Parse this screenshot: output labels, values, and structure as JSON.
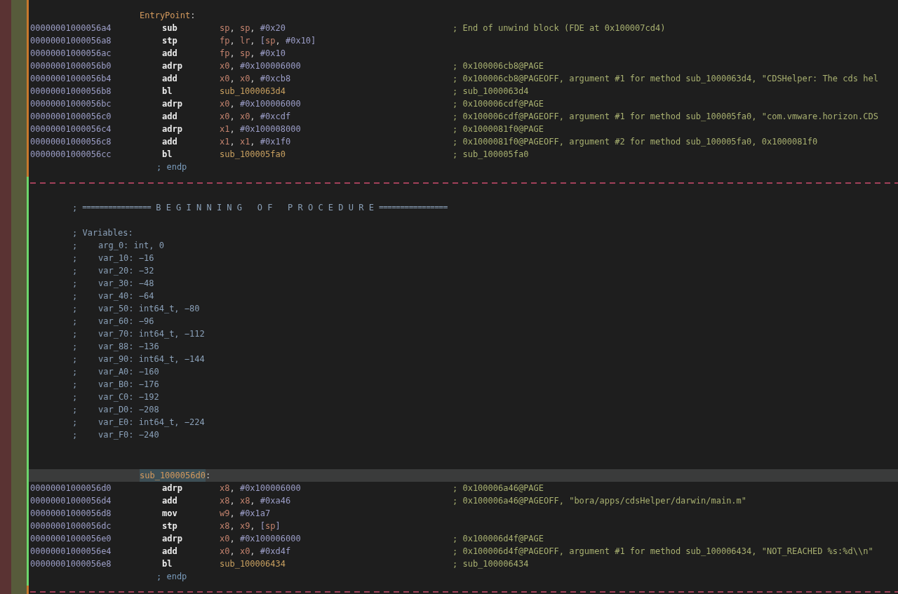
{
  "blocks": [
    {
      "color": "#c8782c",
      "label": {
        "name": "EntryPoint",
        "colon": ":",
        "selected": false
      },
      "instructions": [
        {
          "address": "00000001000056a4",
          "mnemonic": "sub",
          "operands": [
            {
              "kind": "reg",
              "text": "sp"
            },
            {
              "kind": "punct",
              "text": ", "
            },
            {
              "kind": "reg",
              "text": "sp"
            },
            {
              "kind": "punct",
              "text": ", "
            },
            {
              "kind": "imm",
              "text": "#0x20"
            }
          ],
          "comment": "; End of unwind block (FDE at 0x100007cd4)"
        },
        {
          "address": "00000001000056a8",
          "mnemonic": "stp",
          "operands": [
            {
              "kind": "reg",
              "text": "fp"
            },
            {
              "kind": "punct",
              "text": ", "
            },
            {
              "kind": "reg",
              "text": "lr"
            },
            {
              "kind": "punct",
              "text": ", "
            },
            {
              "kind": "imm",
              "text": "["
            },
            {
              "kind": "reg",
              "text": "sp"
            },
            {
              "kind": "punct",
              "text": ", "
            },
            {
              "kind": "imm",
              "text": "#0x10"
            },
            {
              "kind": "imm",
              "text": "]"
            }
          ]
        },
        {
          "address": "00000001000056ac",
          "mnemonic": "add",
          "operands": [
            {
              "kind": "reg",
              "text": "fp"
            },
            {
              "kind": "punct",
              "text": ", "
            },
            {
              "kind": "reg",
              "text": "sp"
            },
            {
              "kind": "punct",
              "text": ", "
            },
            {
              "kind": "imm",
              "text": "#0x10"
            }
          ]
        },
        {
          "address": "00000001000056b0",
          "mnemonic": "adrp",
          "operands": [
            {
              "kind": "reg",
              "text": "x0"
            },
            {
              "kind": "punct",
              "text": ", "
            },
            {
              "kind": "imm",
              "text": "#0x100006000"
            }
          ],
          "comment": "; 0x100006cb8@PAGE"
        },
        {
          "address": "00000001000056b4",
          "mnemonic": "add",
          "operands": [
            {
              "kind": "reg",
              "text": "x0"
            },
            {
              "kind": "punct",
              "text": ", "
            },
            {
              "kind": "reg",
              "text": "x0"
            },
            {
              "kind": "punct",
              "text": ", "
            },
            {
              "kind": "imm",
              "text": "#0xcb8"
            }
          ],
          "comment": "; 0x100006cb8@PAGEOFF, argument #1 for method sub_1000063d4, \"CDSHelper: The cds hel"
        },
        {
          "address": "00000001000056b8",
          "mnemonic": "bl",
          "operands": [
            {
              "kind": "sym",
              "text": "sub_1000063d4"
            }
          ],
          "comment": "; sub_1000063d4"
        },
        {
          "address": "00000001000056bc",
          "mnemonic": "adrp",
          "operands": [
            {
              "kind": "reg",
              "text": "x0"
            },
            {
              "kind": "punct",
              "text": ", "
            },
            {
              "kind": "imm",
              "text": "#0x100006000"
            }
          ],
          "comment": "; 0x100006cdf@PAGE"
        },
        {
          "address": "00000001000056c0",
          "mnemonic": "add",
          "operands": [
            {
              "kind": "reg",
              "text": "x0"
            },
            {
              "kind": "punct",
              "text": ", "
            },
            {
              "kind": "reg",
              "text": "x0"
            },
            {
              "kind": "punct",
              "text": ", "
            },
            {
              "kind": "imm",
              "text": "#0xcdf"
            }
          ],
          "comment": "; 0x100006cdf@PAGEOFF, argument #1 for method sub_100005fa0, \"com.vmware.horizon.CDS"
        },
        {
          "address": "00000001000056c4",
          "mnemonic": "adrp",
          "operands": [
            {
              "kind": "reg",
              "text": "x1"
            },
            {
              "kind": "punct",
              "text": ", "
            },
            {
              "kind": "imm",
              "text": "#0x100008000"
            }
          ],
          "comment": "; 0x1000081f0@PAGE"
        },
        {
          "address": "00000001000056c8",
          "mnemonic": "add",
          "operands": [
            {
              "kind": "reg",
              "text": "x1"
            },
            {
              "kind": "punct",
              "text": ", "
            },
            {
              "kind": "reg",
              "text": "x1"
            },
            {
              "kind": "punct",
              "text": ", "
            },
            {
              "kind": "imm",
              "text": "#0x1f0"
            }
          ],
          "comment": "; 0x1000081f0@PAGEOFF, argument #2 for method sub_100005fa0, 0x1000081f0"
        },
        {
          "address": "00000001000056cc",
          "mnemonic": "bl",
          "operands": [
            {
              "kind": "sym",
              "text": "sub_100005fa0"
            }
          ],
          "comment": "; sub_100005fa0"
        }
      ],
      "endp": "; endp"
    },
    {
      "color": "#6cd66c",
      "header": {
        "semicolon": ";",
        "rule_left": "================",
        "title": "B E G I N N I N G   O F   P R O C E D U R E",
        "rule_right": "================"
      },
      "variables_title": "; Variables:",
      "variables": [
        {
          "semicolon": ";",
          "text": "arg_0: int, 0"
        },
        {
          "semicolon": ";",
          "text": "var_10: −16"
        },
        {
          "semicolon": ";",
          "text": "var_20: −32"
        },
        {
          "semicolon": ";",
          "text": "var_30: −48"
        },
        {
          "semicolon": ";",
          "text": "var_40: −64"
        },
        {
          "semicolon": ";",
          "text": "var_50: int64_t, −80"
        },
        {
          "semicolon": ";",
          "text": "var_60: −96"
        },
        {
          "semicolon": ";",
          "text": "var_70: int64_t, −112"
        },
        {
          "semicolon": ";",
          "text": "var_88: −136"
        },
        {
          "semicolon": ";",
          "text": "var_90: int64_t, −144"
        },
        {
          "semicolon": ";",
          "text": "var_A0: −160"
        },
        {
          "semicolon": ";",
          "text": "var_B0: −176"
        },
        {
          "semicolon": ";",
          "text": "var_C0: −192"
        },
        {
          "semicolon": ";",
          "text": "var_D0: −208"
        },
        {
          "semicolon": ";",
          "text": "var_E0: int64_t, −224"
        },
        {
          "semicolon": ";",
          "text": "var_F0: −240"
        }
      ],
      "label": {
        "name": "sub_1000056d0",
        "colon": ":",
        "selected": true
      },
      "instructions": [
        {
          "address": "00000001000056d0",
          "mnemonic": "adrp",
          "operands": [
            {
              "kind": "reg",
              "text": "x8"
            },
            {
              "kind": "punct",
              "text": ", "
            },
            {
              "kind": "imm",
              "text": "#0x100006000"
            }
          ],
          "comment": "; 0x100006a46@PAGE"
        },
        {
          "address": "00000001000056d4",
          "mnemonic": "add",
          "operands": [
            {
              "kind": "reg",
              "text": "x8"
            },
            {
              "kind": "punct",
              "text": ", "
            },
            {
              "kind": "reg",
              "text": "x8"
            },
            {
              "kind": "punct",
              "text": ", "
            },
            {
              "kind": "imm",
              "text": "#0xa46"
            }
          ],
          "comment": "; 0x100006a46@PAGEOFF, \"bora/apps/cdsHelper/darwin/main.m\""
        },
        {
          "address": "00000001000056d8",
          "mnemonic": "mov",
          "operands": [
            {
              "kind": "reg",
              "text": "w9"
            },
            {
              "kind": "punct",
              "text": ", "
            },
            {
              "kind": "imm",
              "text": "#0x1a7"
            }
          ]
        },
        {
          "address": "00000001000056dc",
          "mnemonic": "stp",
          "operands": [
            {
              "kind": "reg",
              "text": "x8"
            },
            {
              "kind": "punct",
              "text": ", "
            },
            {
              "kind": "reg",
              "text": "x9"
            },
            {
              "kind": "punct",
              "text": ", "
            },
            {
              "kind": "imm",
              "text": "["
            },
            {
              "kind": "reg",
              "text": "sp"
            },
            {
              "kind": "imm",
              "text": "]"
            }
          ]
        },
        {
          "address": "00000001000056e0",
          "mnemonic": "adrp",
          "operands": [
            {
              "kind": "reg",
              "text": "x0"
            },
            {
              "kind": "punct",
              "text": ", "
            },
            {
              "kind": "imm",
              "text": "#0x100006000"
            }
          ],
          "comment": "; 0x100006d4f@PAGE"
        },
        {
          "address": "00000001000056e4",
          "mnemonic": "add",
          "operands": [
            {
              "kind": "reg",
              "text": "x0"
            },
            {
              "kind": "punct",
              "text": ", "
            },
            {
              "kind": "reg",
              "text": "x0"
            },
            {
              "kind": "punct",
              "text": ", "
            },
            {
              "kind": "imm",
              "text": "#0xd4f"
            }
          ],
          "comment": "; 0x100006d4f@PAGEOFF, argument #1 for method sub_100006434, \"NOT_REACHED %s:%d\\\\n\""
        },
        {
          "address": "00000001000056e8",
          "mnemonic": "bl",
          "operands": [
            {
              "kind": "sym",
              "text": "sub_100006434"
            }
          ],
          "comment": "; sub_100006434"
        }
      ],
      "endp": "; endp"
    },
    {
      "color": "#c8782c"
    }
  ]
}
